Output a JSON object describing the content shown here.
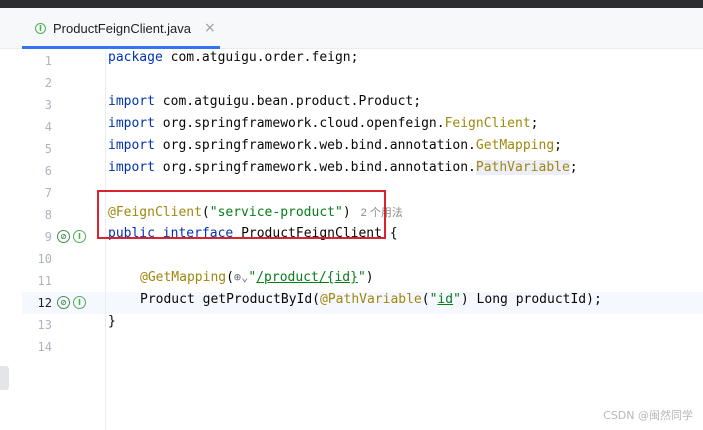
{
  "window": {
    "tab_label": "ProductFeignClient.java",
    "tab_close": "×",
    "tab_icon": "I"
  },
  "editor": {
    "line_numbers": [
      "1",
      "2",
      "3",
      "4",
      "5",
      "6",
      "7",
      "8",
      "9",
      "10",
      "11",
      "12",
      "13",
      "14"
    ],
    "lines": {
      "l1": {
        "kw": "package",
        "rest": " com.atguigu.order.feign;"
      },
      "l3": {
        "kw": "import",
        "rest": " com.atguigu.bean.product.Product;"
      },
      "l4": {
        "kw": "import",
        "rest": " org.springframework.cloud.openfeign.",
        "ann": "FeignClient",
        "end": ";"
      },
      "l5": {
        "kw": "import",
        "rest": " org.springframework.web.bind.annotation.",
        "ann": "GetMapping",
        "end": ";"
      },
      "l6": {
        "kw": "import",
        "rest": " org.springframework.web.bind.annotation.",
        "ann": "PathVariable",
        "end": ";"
      },
      "l8": {
        "ann": "@FeignClient",
        "p1": "(",
        "str": "\"service-product\"",
        "p2": ")",
        "hint": "2 个用法"
      },
      "l9": {
        "kw1": "public",
        "sp": " ",
        "kw2": "interface",
        "rest": " ProductFeignClient {"
      },
      "l11": {
        "ann": "@GetMapping",
        "p1": "(",
        "globe": "⊕",
        "arrow": "⌄",
        "q1": "\"",
        "url": "/product/{id}",
        "q2": "\"",
        "p2": ")"
      },
      "l12": {
        "pre": "Product getProductById(",
        "ann": "@PathVariable",
        "p1": "(",
        "q1": "\"",
        "str": "id",
        "q2": "\"",
        "rest": ") Long productId);"
      },
      "l13": {
        "text": "}"
      }
    }
  },
  "gutter_icons": {
    "bean": "bean-icon",
    "implemented": "implemented-icon"
  },
  "watermark": "CSDN @闽然同学",
  "colors": {
    "keyword": "#0033b3",
    "annotation": "#9e880d",
    "string": "#067d17",
    "highlight_box": "#d9232e"
  }
}
